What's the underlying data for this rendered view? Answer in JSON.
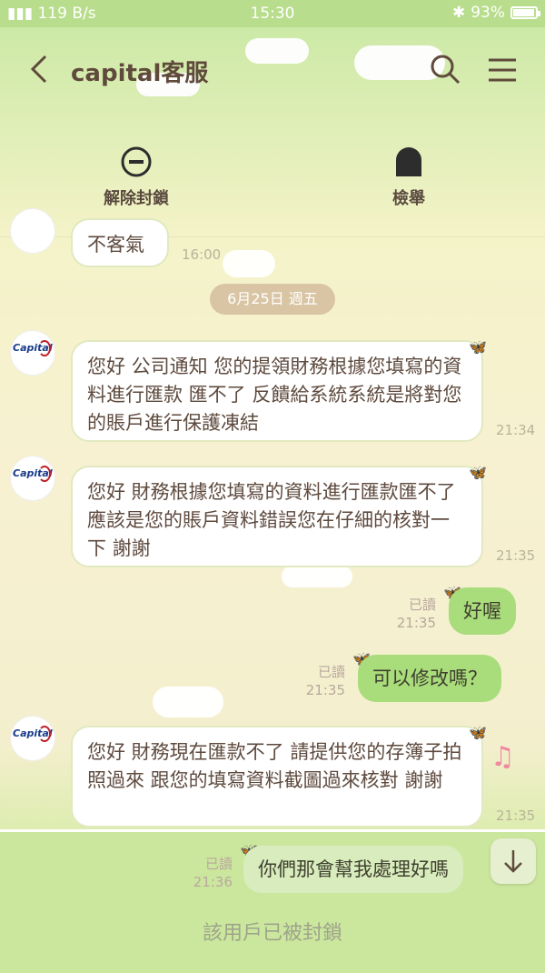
{
  "status": {
    "network": "119 B/s",
    "time": "15:30",
    "battery": "93%"
  },
  "header": {
    "title": "capital客服"
  },
  "actions": {
    "unblock": "解除封鎖",
    "report": "檢舉"
  },
  "chat": {
    "prev_message": "不客氣",
    "prev_time": "16:00",
    "date_chip": "6月25日 週五",
    "incoming": [
      {
        "text": "您好 公司通知 您的提領財務根據您填寫的資料進行匯款 匯不了 反饋給系統系統是將對您的賬戶進行保護凍結",
        "time": "21:34"
      },
      {
        "text": "您好 財務根據您填寫的資料進行匯款匯不了 應該是您的賬戶資料錯誤您在仔細的核對一下 謝謝",
        "time": "21:35"
      },
      {
        "text": "您好 財務現在匯款不了 請提供您的存簿子拍照過來 跟您的填寫資料截圖過來核對 謝謝",
        "time": "21:35"
      }
    ],
    "outgoing": [
      {
        "text": "好喔",
        "read": "已讀",
        "time": "21:35"
      },
      {
        "text": "可以修改嗎？",
        "read": "已讀",
        "time": "21:35"
      },
      {
        "text": "你們那會幫我處理好嗎",
        "read": "已讀",
        "time": "21:36"
      }
    ]
  },
  "footer": {
    "blocked_text": "該用戶已被封鎖"
  }
}
